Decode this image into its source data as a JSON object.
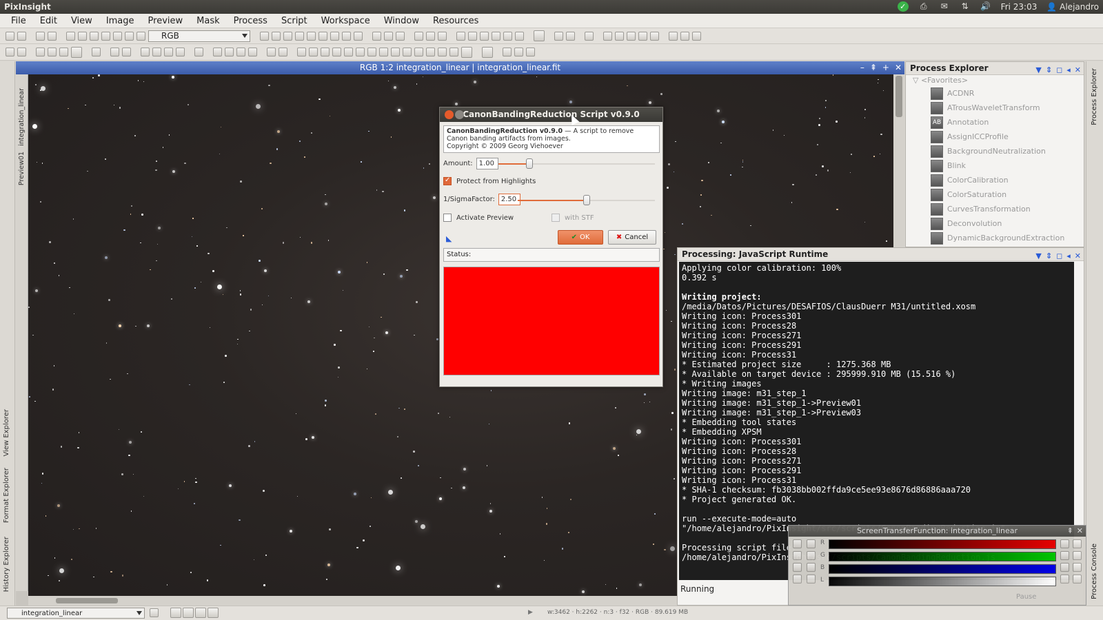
{
  "topbar": {
    "app": "PixInsight",
    "clock": "Fri 23:03",
    "user": "Alejandro"
  },
  "menu": [
    "File",
    "Edit",
    "View",
    "Image",
    "Preview",
    "Mask",
    "Process",
    "Script",
    "Workspace",
    "Window",
    "Resources"
  ],
  "toolbar": {
    "color_space": "RGB"
  },
  "image_window": {
    "title": "RGB 1:2 integration_linear | integration_linear.fit",
    "tab_main": "integration_linear",
    "tab_preview": "Preview01"
  },
  "process_explorer": {
    "title": "Process Explorer",
    "folder": "<Favorites>",
    "items": [
      {
        "label": "ACDNR",
        "icon": "acdnr-icon"
      },
      {
        "label": "ATrousWaveletTransform",
        "icon": "wavelet-icon"
      },
      {
        "label": "Annotation",
        "icon": "annotation-icon"
      },
      {
        "label": "AssignICCProfile",
        "icon": "icc-icon"
      },
      {
        "label": "BackgroundNeutralization",
        "icon": "bg-neutral-icon"
      },
      {
        "label": "Blink",
        "icon": "blink-icon"
      },
      {
        "label": "ColorCalibration",
        "icon": "color-cal-icon"
      },
      {
        "label": "ColorSaturation",
        "icon": "color-sat-icon"
      },
      {
        "label": "CurvesTransformation",
        "icon": "curves-icon"
      },
      {
        "label": "Deconvolution",
        "icon": "deconv-icon"
      },
      {
        "label": "DynamicBackgroundExtraction",
        "icon": "dbe-icon"
      }
    ]
  },
  "console": {
    "title": "Processing: JavaScript Runtime",
    "lines": [
      "Applying color calibration: 100%",
      "0.392 s",
      "",
      "Writing project:",
      "/media/Datos/Pictures/DESAFIOS/ClausDuerr M31/untitled.xosm",
      "Writing icon: Process301",
      "Writing icon: Process28",
      "Writing icon: Process271",
      "Writing icon: Process291",
      "Writing icon: Process31",
      "* Estimated project size     : 1275.368 MB",
      "* Available on target device : 295999.910 MB (15.516 %)",
      "* Writing images",
      "Writing image: m31_step_1",
      "Writing image: m31_step_1->Preview01",
      "Writing image: m31_step_1->Preview03",
      "* Embedding tool states",
      "* Embedding XPSM",
      "Writing icon: Process301",
      "Writing icon: Process28",
      "Writing icon: Process271",
      "Writing icon: Process291",
      "Writing icon: Process31",
      "* SHA-1 checksum: fb3038bb002ffda9ce5ee93e8676d86886aaa720",
      "* Project generated OK.",
      "",
      "run --execute-mode=auto",
      "\"/home/alejandro/PixInsight/src/scripts/CanonBandingReduction.js\"",
      "",
      "Processing script file:",
      "/home/alejandro/PixInsight/src/scripts/CanonBandingReduction.js"
    ],
    "status": "Running"
  },
  "stf": {
    "title": "ScreenTransferFunction: integration_linear",
    "channels": [
      "R",
      "G",
      "B",
      "L"
    ],
    "pause_label": "Pause"
  },
  "dialog": {
    "title": "CanonBandingReduction Script v0.9.0",
    "info_bold": "CanonBandingReduction v0.9.0",
    "info_text": " — A script to remove Canon banding artifacts from images.",
    "copyright": "Copyright © 2009 Georg Viehoever",
    "amount_label": "Amount:",
    "amount_value": "1.00",
    "amount_fraction": 0.2,
    "protect_label": "Protect from Highlights",
    "protect_checked": true,
    "sigma_label": "1/SigmaFactor:",
    "sigma_value": "2.50",
    "sigma_fraction": 0.5,
    "preview_label": "Activate Preview",
    "stf_label": "with STF",
    "ok_label": "OK",
    "cancel_label": "Cancel",
    "status_label": "Status:",
    "preview_color": "#ff0000"
  },
  "statusbar": {
    "view": "integration_linear",
    "info": "w:3462  ·  h:2262  ·  n:3  ·  f32  ·  RGB  ·  89.619 MB"
  }
}
